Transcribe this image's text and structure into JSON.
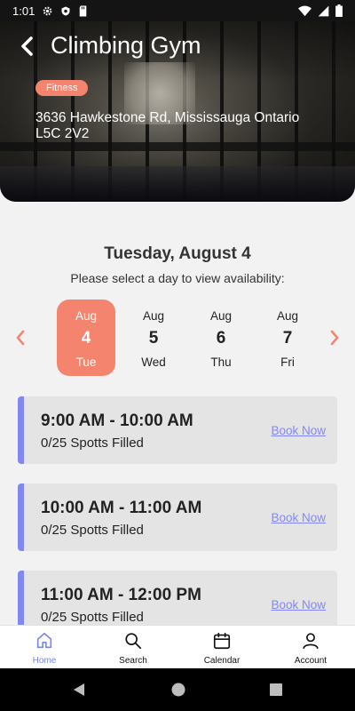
{
  "status_bar": {
    "time": "1:01"
  },
  "header": {
    "title": "Climbing Gym",
    "tag": "Fitness",
    "address": "3636 Hawkestone Rd, Mississauga Ontario L5C 2V2"
  },
  "schedule": {
    "heading": "Tuesday, August 4",
    "subheading": "Please select a day to view availability:",
    "days": [
      {
        "month": "Aug",
        "day": "4",
        "weekday": "Tue",
        "selected": true
      },
      {
        "month": "Aug",
        "day": "5",
        "weekday": "Wed"
      },
      {
        "month": "Aug",
        "day": "6",
        "weekday": "Thu"
      },
      {
        "month": "Aug",
        "day": "7",
        "weekday": "Fri"
      }
    ]
  },
  "slots": [
    {
      "time": "9:00 AM - 10:00 AM",
      "filled": "0/25 Spotts Filled",
      "action": "Book Now"
    },
    {
      "time": "10:00 AM - 11:00 AM",
      "filled": "0/25 Spotts Filled",
      "action": "Book Now"
    },
    {
      "time": "11:00 AM - 12:00 PM",
      "filled": "0/25 Spotts Filled",
      "action": "Book Now"
    }
  ],
  "bottom_nav": [
    {
      "label": "Home",
      "icon": "home-icon",
      "active": true
    },
    {
      "label": "Search",
      "icon": "search-icon"
    },
    {
      "label": "Calendar",
      "icon": "calendar-icon"
    },
    {
      "label": "Account",
      "icon": "account-icon"
    }
  ],
  "colors": {
    "accent": "#f4846e",
    "slot_bar": "#8388f0",
    "nav_active": "#7b87e6"
  }
}
